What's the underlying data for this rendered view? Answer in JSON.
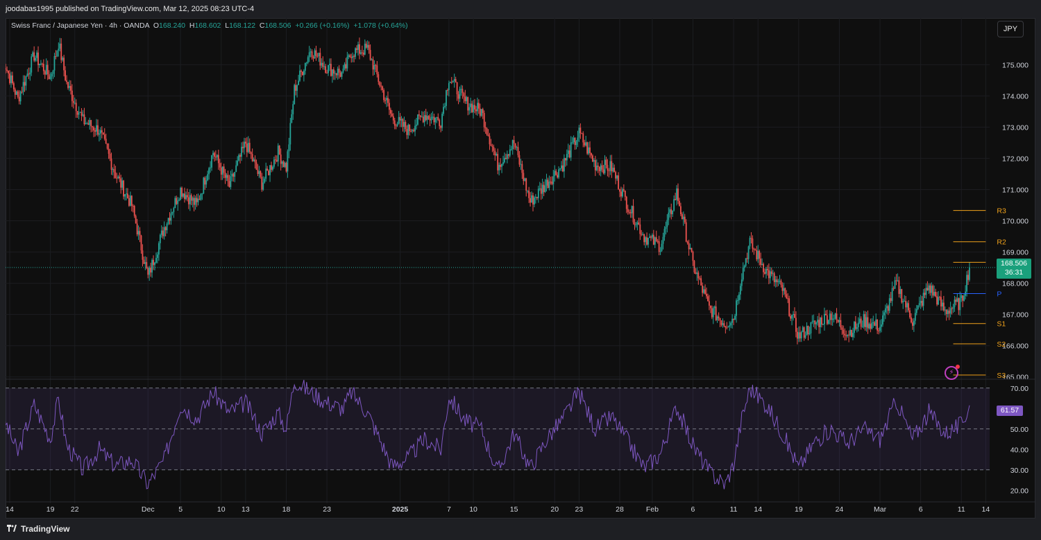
{
  "header": {
    "published": "joodabas1995 published on TradingView.com, Mar 12, 2025 08:23 UTC-4"
  },
  "legend": {
    "symbol": "Swiss Franc / Japanese Yen · 4h · OANDA",
    "o_label": "O",
    "o": "168.240",
    "h_label": "H",
    "h": "168.602",
    "l_label": "L",
    "l": "168.122",
    "c_label": "C",
    "c": "168.506",
    "change": "+0.266 (+0.16%)",
    "change2": "+1.078 (+0.64%)"
  },
  "currency_button": "JPY",
  "price_tag": {
    "price": "168.506",
    "countdown": "36:31"
  },
  "rsi_tag": "61.57",
  "footer": {
    "brand": "TradingView"
  },
  "colors": {
    "up": "#26a69a",
    "down": "#ef5350",
    "pivot_sr": "#f0a21b",
    "pivot_p": "#2962ff",
    "rsi": "#7e57c2",
    "panel_bg": "#0f0f0f"
  },
  "chart_data": [
    {
      "type": "candlestick",
      "title": "Swiss Franc / Japanese Yen · 4h · OANDA",
      "ylim": [
        164.95,
        176.05
      ],
      "y_ticks": [
        165,
        166,
        167,
        168,
        169,
        170,
        171,
        172,
        173,
        174,
        175
      ],
      "y_tick_labels": [
        "165.000",
        "166.000",
        "167.000",
        "168.000",
        "169.000",
        "170.000",
        "171.000",
        "172.000",
        "173.000",
        "174.000",
        "175.000"
      ],
      "x_tick_labels": [
        "14",
        "19",
        "22",
        "Dec",
        "5",
        "10",
        "13",
        "18",
        "23",
        "2025",
        "7",
        "10",
        "15",
        "20",
        "23",
        "28",
        "Feb",
        "6",
        "11",
        "14",
        "19",
        "24",
        "Mar",
        "6",
        "11",
        "14"
      ],
      "x_tick_dates": [
        "2024-11-14",
        "2024-11-19",
        "2024-11-22",
        "2024-12-01",
        "2024-12-05",
        "2024-12-10",
        "2024-12-13",
        "2024-12-18",
        "2024-12-23",
        "2025-01-01",
        "2025-01-07",
        "2025-01-10",
        "2025-01-15",
        "2025-01-20",
        "2025-01-23",
        "2025-01-28",
        "2025-02-01",
        "2025-02-06",
        "2025-02-11",
        "2025-02-14",
        "2025-02-19",
        "2025-02-24",
        "2025-03-01",
        "2025-03-06",
        "2025-03-11",
        "2025-03-14"
      ],
      "close_path": [
        [
          "2024-11-13",
          175.3
        ],
        [
          "2024-11-15",
          173.9
        ],
        [
          "2024-11-17",
          175.3
        ],
        [
          "2024-11-19",
          174.6
        ],
        [
          "2024-11-20",
          175.7
        ],
        [
          "2024-11-21",
          174.4
        ],
        [
          "2024-11-23",
          173.2
        ],
        [
          "2024-11-25",
          172.9
        ],
        [
          "2024-11-27",
          171.5
        ],
        [
          "2024-11-29",
          170.5
        ],
        [
          "2024-12-01",
          168.2
        ],
        [
          "2024-12-03",
          169.8
        ],
        [
          "2024-12-05",
          171.0
        ],
        [
          "2024-12-07",
          170.5
        ],
        [
          "2024-12-09",
          172.2
        ],
        [
          "2024-12-11",
          171.1
        ],
        [
          "2024-12-13",
          172.5
        ],
        [
          "2024-12-15",
          171.2
        ],
        [
          "2024-12-17",
          172.2
        ],
        [
          "2024-12-18",
          171.7
        ],
        [
          "2024-12-19",
          174.2
        ],
        [
          "2024-12-21",
          175.5
        ],
        [
          "2024-12-23",
          174.9
        ],
        [
          "2024-12-25",
          174.7
        ],
        [
          "2024-12-26",
          175.4
        ],
        [
          "2024-12-28",
          175.5
        ],
        [
          "2024-12-31",
          173.3
        ],
        [
          "2025-01-02",
          172.9
        ],
        [
          "2025-01-04",
          173.4
        ],
        [
          "2025-01-06",
          173.2
        ],
        [
          "2025-01-07",
          174.6
        ],
        [
          "2025-01-09",
          173.8
        ],
        [
          "2025-01-11",
          173.5
        ],
        [
          "2025-01-13",
          171.8
        ],
        [
          "2025-01-15",
          172.5
        ],
        [
          "2025-01-17",
          170.6
        ],
        [
          "2025-01-19",
          171.2
        ],
        [
          "2025-01-21",
          171.8
        ],
        [
          "2025-01-23",
          172.8
        ],
        [
          "2025-01-25",
          171.8
        ],
        [
          "2025-01-27",
          171.7
        ],
        [
          "2025-01-29",
          170.5
        ],
        [
          "2025-01-31",
          169.5
        ],
        [
          "2025-02-02",
          169.2
        ],
        [
          "2025-02-04",
          170.9
        ],
        [
          "2025-02-06",
          168.6
        ],
        [
          "2025-02-08",
          167.2
        ],
        [
          "2025-02-10",
          166.7
        ],
        [
          "2025-02-11",
          166.9
        ],
        [
          "2025-02-12",
          168.3
        ],
        [
          "2025-02-13",
          169.3
        ],
        [
          "2025-02-15",
          168.4
        ],
        [
          "2025-02-17",
          167.8
        ],
        [
          "2025-02-19",
          166.3
        ],
        [
          "2025-02-21",
          166.7
        ],
        [
          "2025-02-23",
          167.0
        ],
        [
          "2025-02-25",
          166.4
        ],
        [
          "2025-02-27",
          166.8
        ],
        [
          "2025-03-01",
          166.6
        ],
        [
          "2025-03-03",
          168.0
        ],
        [
          "2025-03-05",
          166.8
        ],
        [
          "2025-03-07",
          167.9
        ],
        [
          "2025-03-09",
          167.1
        ],
        [
          "2025-03-11",
          167.4
        ],
        [
          "2025-03-12",
          168.506
        ]
      ],
      "pivot_levels": [
        {
          "label": "R3",
          "value": 170.33
        },
        {
          "label": "R2",
          "value": 169.33
        },
        {
          "label": "R1",
          "value": 168.67
        },
        {
          "label": "P",
          "value": 167.67
        },
        {
          "label": "S1",
          "value": 166.71
        },
        {
          "label": "S2",
          "value": 166.06
        },
        {
          "label": "S3",
          "value": 165.06
        }
      ],
      "pivot_start": "2025-03-10",
      "pivot_end": "2025-03-14",
      "last_price": 168.506
    },
    {
      "type": "line",
      "title": "RSI",
      "ylim": [
        15,
        74
      ],
      "y_ticks": [
        20,
        30,
        40,
        50,
        60,
        70
      ],
      "y_tick_labels": [
        "20.00",
        "30.00",
        "40.00",
        "50.00",
        "",
        "70.00"
      ],
      "band": [
        30,
        70
      ],
      "midline": 50,
      "last_value": 61.57,
      "path": [
        [
          "2024-11-13",
          58
        ],
        [
          "2024-11-15",
          38
        ],
        [
          "2024-11-17",
          62
        ],
        [
          "2024-11-19",
          45
        ],
        [
          "2024-11-20",
          65
        ],
        [
          "2024-11-21",
          42
        ],
        [
          "2024-11-23",
          30
        ],
        [
          "2024-11-25",
          40
        ],
        [
          "2024-11-27",
          32
        ],
        [
          "2024-11-29",
          35
        ],
        [
          "2024-12-01",
          23
        ],
        [
          "2024-12-03",
          35
        ],
        [
          "2024-12-05",
          62
        ],
        [
          "2024-12-07",
          55
        ],
        [
          "2024-12-09",
          68
        ],
        [
          "2024-12-11",
          58
        ],
        [
          "2024-12-13",
          63
        ],
        [
          "2024-12-15",
          48
        ],
        [
          "2024-12-17",
          58
        ],
        [
          "2024-12-18",
          50
        ],
        [
          "2024-12-19",
          74
        ],
        [
          "2024-12-21",
          68
        ],
        [
          "2024-12-23",
          63
        ],
        [
          "2024-12-25",
          60
        ],
        [
          "2024-12-26",
          68
        ],
        [
          "2024-12-28",
          58
        ],
        [
          "2024-12-31",
          32
        ],
        [
          "2025-01-02",
          36
        ],
        [
          "2025-01-04",
          45
        ],
        [
          "2025-01-06",
          40
        ],
        [
          "2025-01-07",
          66
        ],
        [
          "2025-01-09",
          54
        ],
        [
          "2025-01-11",
          50
        ],
        [
          "2025-01-13",
          29
        ],
        [
          "2025-01-15",
          48
        ],
        [
          "2025-01-17",
          31
        ],
        [
          "2025-01-19",
          45
        ],
        [
          "2025-01-21",
          55
        ],
        [
          "2025-01-23",
          68
        ],
        [
          "2025-01-25",
          50
        ],
        [
          "2025-01-27",
          56
        ],
        [
          "2025-01-29",
          44
        ],
        [
          "2025-01-31",
          31
        ],
        [
          "2025-02-02",
          38
        ],
        [
          "2025-02-04",
          61
        ],
        [
          "2025-02-06",
          42
        ],
        [
          "2025-02-08",
          29
        ],
        [
          "2025-02-10",
          23
        ],
        [
          "2025-02-11",
          33
        ],
        [
          "2025-02-12",
          55
        ],
        [
          "2025-02-13",
          70
        ],
        [
          "2025-02-15",
          62
        ],
        [
          "2025-02-17",
          48
        ],
        [
          "2025-02-19",
          31
        ],
        [
          "2025-02-21",
          44
        ],
        [
          "2025-02-23",
          50
        ],
        [
          "2025-02-25",
          43
        ],
        [
          "2025-02-27",
          50
        ],
        [
          "2025-03-01",
          45
        ],
        [
          "2025-03-03",
          64
        ],
        [
          "2025-03-05",
          45
        ],
        [
          "2025-03-07",
          58
        ],
        [
          "2025-03-09",
          48
        ],
        [
          "2025-03-11",
          52
        ],
        [
          "2025-03-12",
          61.57
        ]
      ]
    }
  ]
}
